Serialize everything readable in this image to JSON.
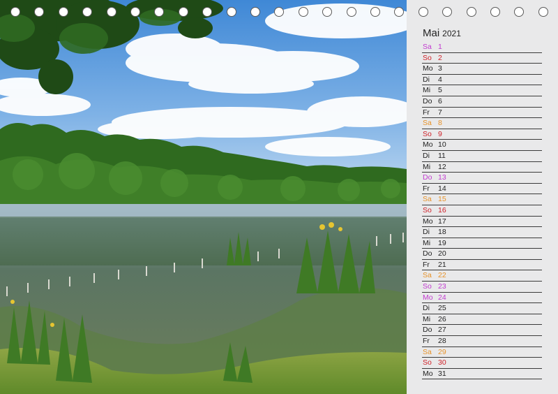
{
  "calendar": {
    "month": "Mai",
    "year": "2021",
    "colors": {
      "default": "#222222",
      "saturday": "#e8932a",
      "sunday": "#d0222a",
      "holiday": "#c23bd0"
    },
    "days": [
      {
        "wd": "Sa",
        "d": "1",
        "color": "#c23bd0"
      },
      {
        "wd": "So",
        "d": "2",
        "color": "#d0222a"
      },
      {
        "wd": "Mo",
        "d": "3",
        "color": "#222222"
      },
      {
        "wd": "Di",
        "d": "4",
        "color": "#222222"
      },
      {
        "wd": "Mi",
        "d": "5",
        "color": "#222222"
      },
      {
        "wd": "Do",
        "d": "6",
        "color": "#222222"
      },
      {
        "wd": "Fr",
        "d": "7",
        "color": "#222222"
      },
      {
        "wd": "Sa",
        "d": "8",
        "color": "#e8932a"
      },
      {
        "wd": "So",
        "d": "9",
        "color": "#d0222a"
      },
      {
        "wd": "Mo",
        "d": "10",
        "color": "#222222"
      },
      {
        "wd": "Di",
        "d": "11",
        "color": "#222222"
      },
      {
        "wd": "Mi",
        "d": "12",
        "color": "#222222"
      },
      {
        "wd": "Do",
        "d": "13",
        "color": "#c23bd0"
      },
      {
        "wd": "Fr",
        "d": "14",
        "color": "#222222"
      },
      {
        "wd": "Sa",
        "d": "15",
        "color": "#e8932a"
      },
      {
        "wd": "So",
        "d": "16",
        "color": "#d0222a"
      },
      {
        "wd": "Mo",
        "d": "17",
        "color": "#222222"
      },
      {
        "wd": "Di",
        "d": "18",
        "color": "#222222"
      },
      {
        "wd": "Mi",
        "d": "19",
        "color": "#222222"
      },
      {
        "wd": "Do",
        "d": "20",
        "color": "#222222"
      },
      {
        "wd": "Fr",
        "d": "21",
        "color": "#222222"
      },
      {
        "wd": "Sa",
        "d": "22",
        "color": "#e8932a"
      },
      {
        "wd": "So",
        "d": "23",
        "color": "#c23bd0"
      },
      {
        "wd": "Mo",
        "d": "24",
        "color": "#c23bd0"
      },
      {
        "wd": "Di",
        "d": "25",
        "color": "#222222"
      },
      {
        "wd": "Mi",
        "d": "26",
        "color": "#222222"
      },
      {
        "wd": "Do",
        "d": "27",
        "color": "#222222"
      },
      {
        "wd": "Fr",
        "d": "28",
        "color": "#222222"
      },
      {
        "wd": "Sa",
        "d": "29",
        "color": "#e8932a"
      },
      {
        "wd": "So",
        "d": "30",
        "color": "#d0222a"
      },
      {
        "wd": "Mo",
        "d": "31",
        "color": "#222222"
      }
    ]
  },
  "binding": {
    "hole_icon": "ring-hole-icon"
  }
}
